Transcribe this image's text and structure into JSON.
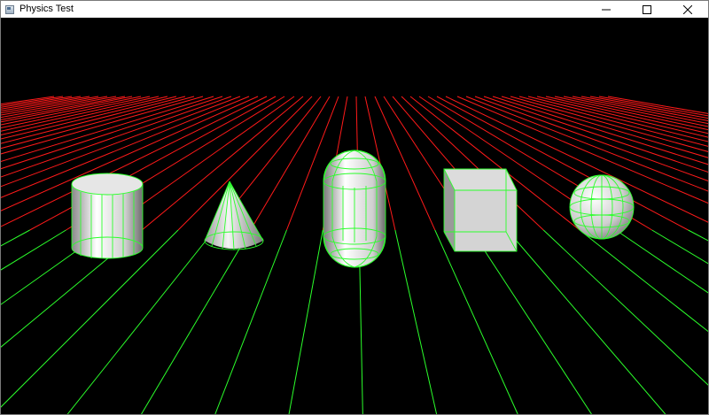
{
  "window": {
    "title": "Physics Test",
    "icon": "app-window-icon",
    "controls": [
      "minimize-icon",
      "maximize-icon",
      "close-icon"
    ]
  },
  "scene": {
    "background": "#000000",
    "grid_colors": {
      "far_lines": "#ff1a1a",
      "near_lines": "#2bff2b"
    },
    "wireframe_color": "#2bff2b",
    "objects": [
      "cylinder",
      "cone",
      "capsule",
      "box",
      "sphere"
    ]
  }
}
